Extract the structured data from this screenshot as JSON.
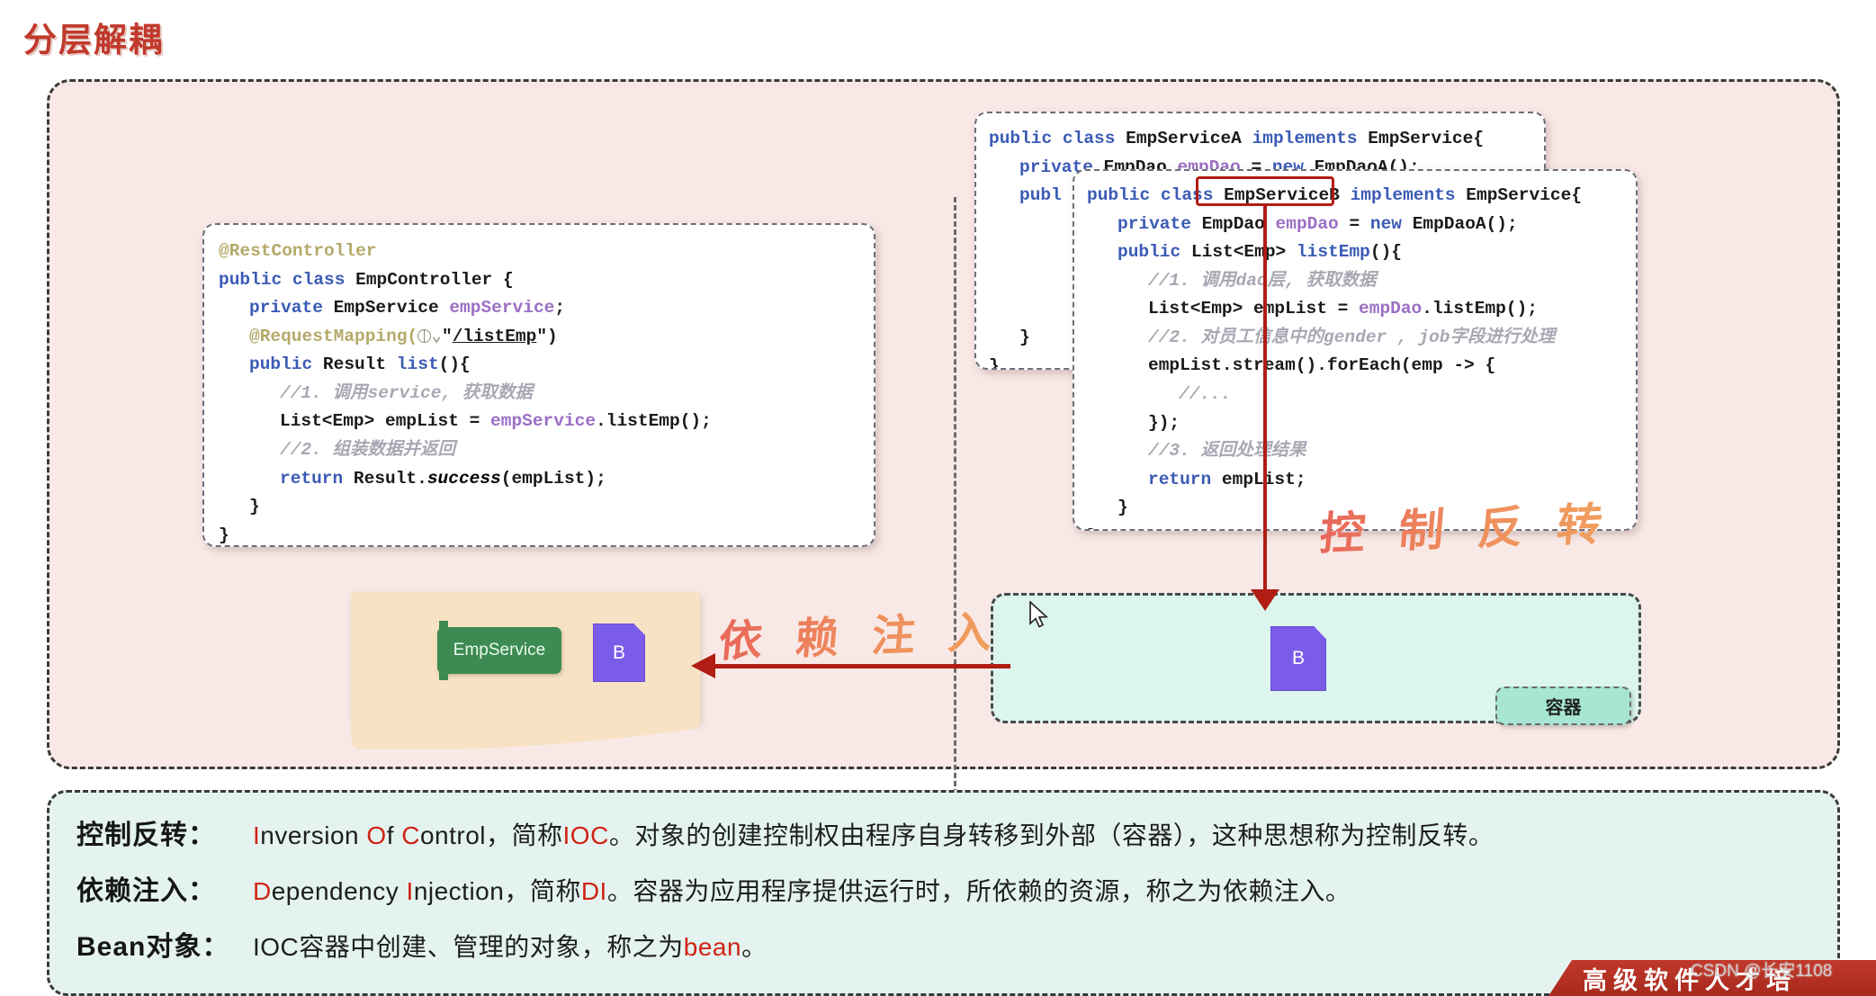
{
  "title": "分层解耦",
  "code_cards": {
    "controller": {
      "name": "EmpController",
      "lines": [
        {
          "indent": 0,
          "segs": [
            {
              "t": "@RestController",
              "c": "ann"
            }
          ]
        },
        {
          "indent": 0,
          "segs": [
            {
              "t": "public class ",
              "c": "kw"
            },
            {
              "t": "EmpController {",
              "c": "pln"
            }
          ]
        },
        {
          "indent": 1,
          "segs": [
            {
              "t": "private ",
              "c": "kw"
            },
            {
              "t": "EmpService ",
              "c": "pln"
            },
            {
              "t": "empService",
              "c": "var"
            },
            {
              "t": ";",
              "c": "pln"
            }
          ]
        },
        {
          "indent": 1,
          "segs": [
            {
              "t": "@RequestMapping(",
              "c": "ann"
            },
            {
              "t": "GLOBE",
              "c": "icon"
            },
            {
              "t": "\"",
              "c": "str"
            },
            {
              "t": "/listEmp",
              "c": "strul"
            },
            {
              "t": "\")",
              "c": "str"
            }
          ]
        },
        {
          "indent": 1,
          "segs": [
            {
              "t": "public ",
              "c": "kw"
            },
            {
              "t": "Result ",
              "c": "pln"
            },
            {
              "t": "list",
              "c": "kw"
            },
            {
              "t": "(){",
              "c": "pln"
            }
          ]
        },
        {
          "indent": 2,
          "segs": [
            {
              "t": "//1. 调用service, 获取数据",
              "c": "cmt"
            }
          ]
        },
        {
          "indent": 2,
          "segs": [
            {
              "t": "List<Emp> empList = ",
              "c": "pln"
            },
            {
              "t": "empService",
              "c": "var"
            },
            {
              "t": ".listEmp();",
              "c": "pln"
            }
          ]
        },
        {
          "indent": 2,
          "segs": [
            {
              "t": "//2. 组装数据并返回",
              "c": "cmt"
            }
          ]
        },
        {
          "indent": 2,
          "segs": [
            {
              "t": "return ",
              "c": "kw"
            },
            {
              "t": "Result.",
              "c": "pln"
            },
            {
              "t": "success",
              "c": "ital"
            },
            {
              "t": "(empList);",
              "c": "pln"
            }
          ]
        },
        {
          "indent": 1,
          "segs": [
            {
              "t": "}",
              "c": "pln"
            }
          ]
        },
        {
          "indent": 0,
          "segs": [
            {
              "t": "}",
              "c": "pln"
            }
          ]
        }
      ]
    },
    "service_a": {
      "name": "EmpServiceA",
      "lines": [
        {
          "indent": 0,
          "segs": [
            {
              "t": "public class ",
              "c": "kw"
            },
            {
              "t": "EmpServiceA ",
              "c": "pln"
            },
            {
              "t": "implements ",
              "c": "kw"
            },
            {
              "t": "EmpService{",
              "c": "pln"
            }
          ]
        },
        {
          "indent": 1,
          "segs": [
            {
              "t": "private ",
              "c": "kw"
            },
            {
              "t": "EmpDao ",
              "c": "pln"
            },
            {
              "t": "empDao",
              "c": "var"
            },
            {
              "t": " = ",
              "c": "pln"
            },
            {
              "t": "new ",
              "c": "kw"
            },
            {
              "t": "EmpDaoA();",
              "c": "pln"
            }
          ]
        },
        {
          "indent": 1,
          "segs": [
            {
              "t": "publ",
              "c": "kw"
            }
          ]
        },
        {
          "indent": 1,
          "segs": [
            {
              "t": "",
              "c": "pln"
            }
          ]
        },
        {
          "indent": 1,
          "segs": [
            {
              "t": "",
              "c": "pln"
            }
          ]
        },
        {
          "indent": 1,
          "segs": [
            {
              "t": "",
              "c": "pln"
            }
          ]
        },
        {
          "indent": 1,
          "segs": [
            {
              "t": "",
              "c": "pln"
            }
          ]
        },
        {
          "indent": 1,
          "segs": [
            {
              "t": "}",
              "c": "pln"
            }
          ]
        },
        {
          "indent": 0,
          "segs": [
            {
              "t": "}",
              "c": "pln"
            }
          ]
        }
      ]
    },
    "service_b": {
      "name": "EmpServiceB",
      "highlighted_token": "EmpServiceB",
      "lines": [
        {
          "indent": 0,
          "segs": [
            {
              "t": "public class ",
              "c": "kw"
            },
            {
              "t": "EmpServiceB ",
              "c": "pln"
            },
            {
              "t": "implements ",
              "c": "kw"
            },
            {
              "t": "EmpService{",
              "c": "pln"
            }
          ]
        },
        {
          "indent": 1,
          "segs": [
            {
              "t": "private ",
              "c": "kw"
            },
            {
              "t": "EmpDao ",
              "c": "pln"
            },
            {
              "t": "empDao",
              "c": "var"
            },
            {
              "t": " = ",
              "c": "pln"
            },
            {
              "t": "new ",
              "c": "kw"
            },
            {
              "t": "EmpDaoA();",
              "c": "pln"
            }
          ]
        },
        {
          "indent": 1,
          "segs": [
            {
              "t": "public ",
              "c": "kw"
            },
            {
              "t": "List<Emp> ",
              "c": "pln"
            },
            {
              "t": "listEmp",
              "c": "kw"
            },
            {
              "t": "(){",
              "c": "pln"
            }
          ]
        },
        {
          "indent": 2,
          "segs": [
            {
              "t": "//1. 调用dao层, 获取数据",
              "c": "cmt"
            }
          ]
        },
        {
          "indent": 2,
          "segs": [
            {
              "t": "List<Emp> empList = ",
              "c": "pln"
            },
            {
              "t": "empDao",
              "c": "var"
            },
            {
              "t": ".listEmp();",
              "c": "pln"
            }
          ]
        },
        {
          "indent": 2,
          "segs": [
            {
              "t": "//2. 对员工信息中的gender , job字段进行处理",
              "c": "cmt"
            }
          ]
        },
        {
          "indent": 2,
          "segs": [
            {
              "t": "empList.stream().forEach(emp -> {",
              "c": "pln"
            }
          ]
        },
        {
          "indent": 3,
          "segs": [
            {
              "t": "//...",
              "c": "cmt"
            }
          ]
        },
        {
          "indent": 2,
          "segs": [
            {
              "t": "});",
              "c": "pln"
            }
          ]
        },
        {
          "indent": 2,
          "segs": [
            {
              "t": "//3. 返回处理结果",
              "c": "cmt"
            }
          ]
        },
        {
          "indent": 2,
          "segs": [
            {
              "t": "return ",
              "c": "kw"
            },
            {
              "t": "empList;",
              "c": "pln"
            }
          ]
        },
        {
          "indent": 1,
          "segs": [
            {
              "t": "}",
              "c": "pln"
            }
          ]
        },
        {
          "indent": 0,
          "segs": [
            {
              "t": "}",
              "c": "pln"
            }
          ]
        }
      ]
    }
  },
  "annotations": {
    "ioc_label": "控 制 反 转",
    "di_label": "依 赖 注 入"
  },
  "shapes": {
    "service_chip_label": "EmpService",
    "bean_left_label": "B",
    "bean_right_label": "B",
    "container_label": "容器"
  },
  "definitions": [
    {
      "term": "控制反转：",
      "parts": [
        {
          "t": "I",
          "red": true
        },
        {
          "t": "nversion ",
          "red": false
        },
        {
          "t": "O",
          "red": true
        },
        {
          "t": "f ",
          "red": false
        },
        {
          "t": "C",
          "red": true
        },
        {
          "t": "ontrol，简称",
          "red": false
        },
        {
          "t": "IOC",
          "red": true
        },
        {
          "t": "。对象的创建控制权由程序自身转移到外部（容器），这种思想称为控制反转。",
          "red": false
        }
      ]
    },
    {
      "term": "依赖注入：",
      "parts": [
        {
          "t": "D",
          "red": true
        },
        {
          "t": "ependency ",
          "red": false
        },
        {
          "t": "I",
          "red": true
        },
        {
          "t": "njection，简称",
          "red": false
        },
        {
          "t": "DI",
          "red": true
        },
        {
          "t": "。容器为应用程序提供运行时，所依赖的资源，称之为依赖注入。",
          "red": false
        }
      ]
    },
    {
      "term": "Bean对象：",
      "parts": [
        {
          "t": "IOC容器中创建、管理的对象，称之为",
          "red": false
        },
        {
          "t": "bean",
          "red": true
        },
        {
          "t": "。",
          "red": false
        }
      ]
    }
  ],
  "footer": {
    "ribbon_text": "高级软件人才培",
    "watermark": "CSDN @长安1108"
  },
  "colors": {
    "title_red": "#c0392b",
    "panel_pink": "#f9e9e6",
    "panel_mint": "#e4f3ef",
    "container_mint": "#dcf6ef",
    "container_tag": "#a6e6d3",
    "service_green": "#3d8b52",
    "bean_purple": "#7b5ce8",
    "app_tan": "#f8e2c4",
    "arrow_red": "#b01d14",
    "accent_red": "#d02316"
  }
}
